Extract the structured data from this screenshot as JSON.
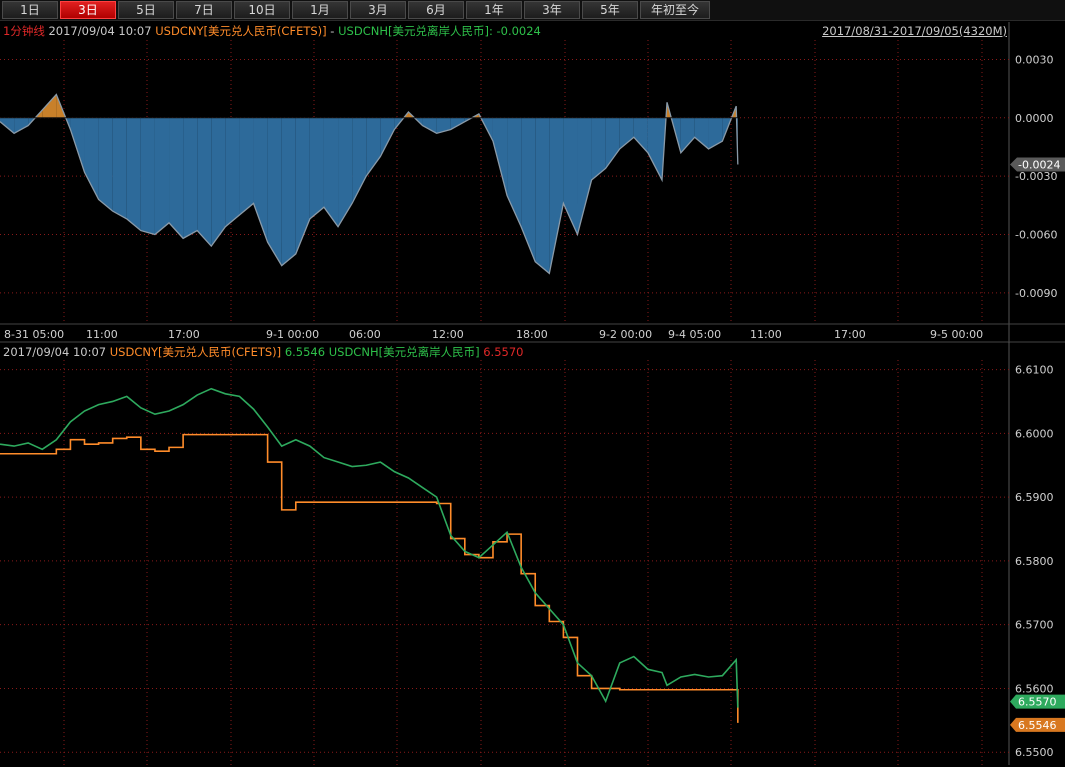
{
  "toolbar": {
    "tabs": [
      "1日",
      "3日",
      "5日",
      "7日",
      "10日",
      "1月",
      "3月",
      "6月",
      "1年",
      "3年",
      "5年",
      "年初至今"
    ],
    "active_tab": "3日"
  },
  "top_panel": {
    "interval_label": "1分钟线",
    "timestamp": "2017/09/04 10:07",
    "series_a": "USDCNY[美元兑人民币(CFETS)]",
    "separator": " - ",
    "series_b": "USDCNH[美元兑离岸人民币]",
    "value_text": ": -0.0024",
    "range": "2017/08/31-2017/09/05(4320M)",
    "last_badge": "-0.0024"
  },
  "bottom_panel": {
    "timestamp": "2017/09/04 10:07",
    "series_a": "USDCNY[美元兑人民币(CFETS)]",
    "series_a_value": "6.5546",
    "series_b": "USDCNH[美元兑离岸人民币]",
    "series_b_value": "6.5570",
    "badge_cnh": "6.5570",
    "badge_cny": "6.5546"
  },
  "colors": {
    "cny": "#ff8c2a",
    "cnh": "#2eaa5e",
    "spread_fill_neg": "#2d6a9a",
    "spread_fill_pos": "#c8802a",
    "spread_line": "#8a9aa8",
    "grid": "#8a1a1a",
    "active_tab": "#d01010"
  },
  "chart_data": [
    {
      "type": "area",
      "series": [
        {
          "name": "USDCNY[美元兑人民币(CFETS)] - USDCNH[美元兑离岸人民币]",
          "x": [
            "2017-08-31 05:00",
            "2017-08-31 06:00",
            "2017-08-31 07:00",
            "2017-08-31 08:00",
            "2017-08-31 09:00",
            "2017-08-31 10:00",
            "2017-08-31 11:00",
            "2017-08-31 12:00",
            "2017-08-31 13:00",
            "2017-08-31 14:00",
            "2017-08-31 15:00",
            "2017-08-31 16:00",
            "2017-08-31 17:00",
            "2017-08-31 18:00",
            "2017-08-31 19:00",
            "2017-08-31 20:00",
            "2017-08-31 21:00",
            "2017-08-31 22:00",
            "2017-08-31 23:00",
            "2017-09-01 00:00",
            "2017-09-01 01:00",
            "2017-09-01 02:00",
            "2017-09-01 03:00",
            "2017-09-01 04:00",
            "2017-09-01 05:00",
            "2017-09-01 06:00",
            "2017-09-01 07:00",
            "2017-09-01 08:00",
            "2017-09-01 09:00",
            "2017-09-01 10:00",
            "2017-09-01 11:00",
            "2017-09-01 12:00",
            "2017-09-01 13:00",
            "2017-09-01 14:00",
            "2017-09-01 15:00",
            "2017-09-01 16:00",
            "2017-09-01 17:00",
            "2017-09-01 18:00",
            "2017-09-01 19:00",
            "2017-09-01 20:00",
            "2017-09-01 21:00",
            "2017-09-01 22:00",
            "2017-09-01 23:00",
            "2017-09-02 00:00",
            "2017-09-02 01:00",
            "2017-09-02 02:00",
            "2017-09-02 03:00",
            "2017-09-02 04:00",
            "2017-09-04 05:00",
            "2017-09-04 06:00",
            "2017-09-04 07:00",
            "2017-09-04 08:00",
            "2017-09-04 09:00",
            "2017-09-04 10:00",
            "2017-09-04 10:07"
          ],
          "values": [
            -0.0002,
            -0.0008,
            -0.0004,
            0.0004,
            0.0012,
            -0.0006,
            -0.0028,
            -0.0042,
            -0.0048,
            -0.0052,
            -0.0058,
            -0.006,
            -0.0054,
            -0.0062,
            -0.0058,
            -0.0066,
            -0.0056,
            -0.005,
            -0.0044,
            -0.0064,
            -0.0076,
            -0.007,
            -0.0052,
            -0.0046,
            -0.0056,
            -0.0044,
            -0.003,
            -0.002,
            -0.0006,
            0.0003,
            -0.0004,
            -0.0008,
            -0.0006,
            -0.0002,
            0.0002,
            -0.0012,
            -0.004,
            -0.0056,
            -0.0074,
            -0.008,
            -0.0044,
            -0.006,
            -0.0032,
            -0.0026,
            -0.0016,
            -0.001,
            -0.0018,
            -0.0032,
            0.0008,
            -0.0018,
            -0.001,
            -0.0016,
            -0.0012,
            0.0006,
            -0.0024
          ]
        }
      ],
      "ylim": [
        -0.0105,
        0.004
      ],
      "yticks": [
        "0.0030",
        "0.0000",
        "-0.0030",
        "-0.0060",
        "-0.0090"
      ],
      "xticks": [
        "8-31 05:00",
        "11:00",
        "17:00",
        "9-1 00:00",
        "06:00",
        "12:00",
        "18:00",
        "9-2 00:00",
        "9-4 05:00",
        "11:00",
        "17:00",
        "9-5 00:00"
      ],
      "grid": true
    },
    {
      "type": "line",
      "x": [
        "2017-08-31 05:00",
        "2017-08-31 06:00",
        "2017-08-31 07:00",
        "2017-08-31 08:00",
        "2017-08-31 09:00",
        "2017-08-31 10:00",
        "2017-08-31 11:00",
        "2017-08-31 12:00",
        "2017-08-31 13:00",
        "2017-08-31 14:00",
        "2017-08-31 15:00",
        "2017-08-31 16:00",
        "2017-08-31 17:00",
        "2017-08-31 18:00",
        "2017-08-31 19:00",
        "2017-08-31 20:00",
        "2017-08-31 21:00",
        "2017-08-31 22:00",
        "2017-08-31 23:00",
        "2017-09-01 00:00",
        "2017-09-01 01:00",
        "2017-09-01 02:00",
        "2017-09-01 03:00",
        "2017-09-01 04:00",
        "2017-09-01 05:00",
        "2017-09-01 06:00",
        "2017-09-01 07:00",
        "2017-09-01 08:00",
        "2017-09-01 09:00",
        "2017-09-01 10:00",
        "2017-09-01 11:00",
        "2017-09-01 12:00",
        "2017-09-01 13:00",
        "2017-09-01 14:00",
        "2017-09-01 15:00",
        "2017-09-01 16:00",
        "2017-09-01 17:00",
        "2017-09-01 18:00",
        "2017-09-01 19:00",
        "2017-09-01 20:00",
        "2017-09-01 21:00",
        "2017-09-01 22:00",
        "2017-09-01 23:00",
        "2017-09-02 00:00",
        "2017-09-02 01:00",
        "2017-09-02 02:00",
        "2017-09-02 03:00",
        "2017-09-02 04:00",
        "2017-09-04 05:00",
        "2017-09-04 06:00",
        "2017-09-04 07:00",
        "2017-09-04 08:00",
        "2017-09-04 09:00",
        "2017-09-04 10:00",
        "2017-09-04 10:07"
      ],
      "series": [
        {
          "name": "USDCNY[美元兑人民币(CFETS)]",
          "values": [
            6.5968,
            6.5968,
            6.5968,
            6.5968,
            6.5975,
            6.599,
            6.5983,
            6.5985,
            6.5992,
            6.5994,
            6.5975,
            6.5972,
            6.5978,
            6.5998,
            6.5998,
            6.5998,
            6.5998,
            6.5998,
            6.5998,
            6.5955,
            6.588,
            6.5892,
            6.5892,
            6.5892,
            6.5892,
            6.5892,
            6.5892,
            6.5892,
            6.5892,
            6.5892,
            6.5892,
            6.589,
            6.5835,
            6.581,
            6.5805,
            6.583,
            6.5842,
            6.578,
            6.573,
            6.5705,
            6.568,
            6.562,
            6.56,
            6.56,
            6.5598,
            6.5598,
            6.5598,
            6.5598,
            6.5598,
            6.5598,
            6.5598,
            6.5598,
            6.5598,
            6.5598,
            6.5546
          ]
        },
        {
          "name": "USDCNH[美元兑离岸人民币]",
          "values": [
            6.5983,
            6.598,
            6.5985,
            6.5975,
            6.599,
            6.6018,
            6.6035,
            6.6045,
            6.605,
            6.6058,
            6.604,
            6.603,
            6.6035,
            6.6045,
            6.606,
            6.607,
            6.6062,
            6.6058,
            6.6038,
            6.601,
            6.598,
            6.599,
            6.598,
            6.5962,
            6.5955,
            6.5948,
            6.595,
            6.5955,
            6.594,
            6.593,
            6.5915,
            6.59,
            6.584,
            6.5815,
            6.5805,
            6.5825,
            6.5845,
            6.579,
            6.575,
            6.5725,
            6.57,
            6.564,
            6.562,
            6.558,
            6.564,
            6.565,
            6.563,
            6.5625,
            6.5605,
            6.5618,
            6.5622,
            6.5618,
            6.562,
            6.5645,
            6.557
          ]
        }
      ],
      "ylim": [
        6.548,
        6.6115
      ],
      "yticks": [
        "6.6100",
        "6.6000",
        "6.5900",
        "6.5800",
        "6.5700",
        "6.5600",
        "6.5500"
      ],
      "xticks": [],
      "grid": true
    }
  ]
}
